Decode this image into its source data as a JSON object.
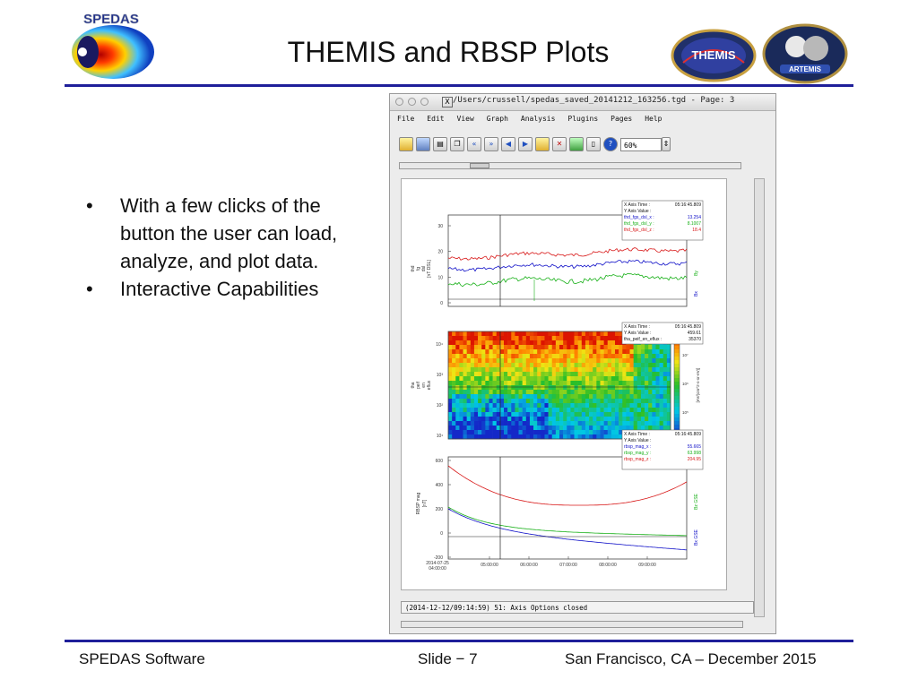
{
  "slide": {
    "title": "THEMIS and RBSP Plots",
    "bullets": [
      "With a few clicks of the button the user can load, analyze, and plot data.",
      "Interactive Capabilities"
    ],
    "footer_left": "SPEDAS Software",
    "footer_center": "Slide − 7",
    "footer_right": "San Francisco, CA – December 2015",
    "logos": {
      "spedas_text": "SPEDAS",
      "themis_text": "THEMIS",
      "artemis_text": "ARTEMIS"
    },
    "rule_color": "#1f1f9a"
  },
  "window": {
    "title": "/Users/crussell/spedas_saved_20141212_163256.tgd - Page: 3",
    "menu": [
      "File",
      "Edit",
      "View",
      "Graph",
      "Analysis",
      "Plugins",
      "Pages",
      "Help"
    ],
    "toolbar_icons": [
      "open-icon",
      "save-icon",
      "print-icon",
      "copy-icon",
      "pan-left-icon",
      "pan-right-icon",
      "back-icon",
      "forward-icon",
      "data-icon",
      "delete-icon",
      "layout-icon",
      "page-icon",
      "help-icon"
    ],
    "zoom": "60%",
    "status": "(2014-12-12/09:14:59) 51: Axis Options closed"
  },
  "panels": {
    "panel1": {
      "ylabel": [
        "thd",
        "fg",
        "dsl",
        "[nT DSL]"
      ],
      "yticks": [
        "30",
        "20",
        "10",
        "0"
      ],
      "right_labels": [
        "Bz",
        "By",
        "Bx"
      ],
      "legend": {
        "x_time_label": "X Axis Time :",
        "x_time_value": "05:16:45.809",
        "y_value_label": "Y Axis Value :",
        "rows": [
          {
            "name": "thd_fgs_dsl_x :",
            "value": "13.254",
            "color": "#1010c8"
          },
          {
            "name": "thd_fgs_dsl_y :",
            "value": "8.1007",
            "color": "#18b018"
          },
          {
            "name": "thd_fgs_dsl_z :",
            "value": "18.4",
            "color": "#d81818"
          }
        ]
      }
    },
    "panel2": {
      "ylabel": [
        "tha",
        "peif",
        "en",
        "eflux"
      ],
      "yticks": [
        "10⁴",
        "10³",
        "10²",
        "10¹"
      ],
      "colorbar_label": "[eV/(cm^2-s-sr-eV)]",
      "colorbar_ticks": [
        "10⁷",
        "10⁶",
        "10⁵"
      ],
      "legend": {
        "x_time_label": "X Axis Time :",
        "x_time_value": "05:16:45.809",
        "y_value_label": "Y Axis Value :",
        "y_value": "459.61",
        "rows": [
          {
            "name": "tha_peif_en_eflux :",
            "value": "35370",
            "color": "#111111"
          }
        ]
      }
    },
    "panel3": {
      "ylabel": [
        "RBSP mag",
        "[nT]"
      ],
      "yticks": [
        "600",
        "400",
        "200",
        "0",
        "-200"
      ],
      "right_labels": [
        "Bz GSE",
        "Bx GSE"
      ],
      "xticks": [
        "05:00:00",
        "06:00:00",
        "07:00:00",
        "08:00:00",
        "09:00:00"
      ],
      "xstart": [
        "2014-07-25",
        "04:00:00"
      ],
      "legend": {
        "x_time_label": "X Axis Time :",
        "x_time_value": "05:16:45.809",
        "y_value_label": "Y Axis Value :",
        "rows": [
          {
            "name": "rbsp_mag_x :",
            "value": "55.665",
            "color": "#1010c8"
          },
          {
            "name": "rbsp_mag_y :",
            "value": "63.998",
            "color": "#18b018"
          },
          {
            "name": "rbsp_mag_z :",
            "value": "204.95",
            "color": "#d81818"
          }
        ]
      }
    }
  }
}
